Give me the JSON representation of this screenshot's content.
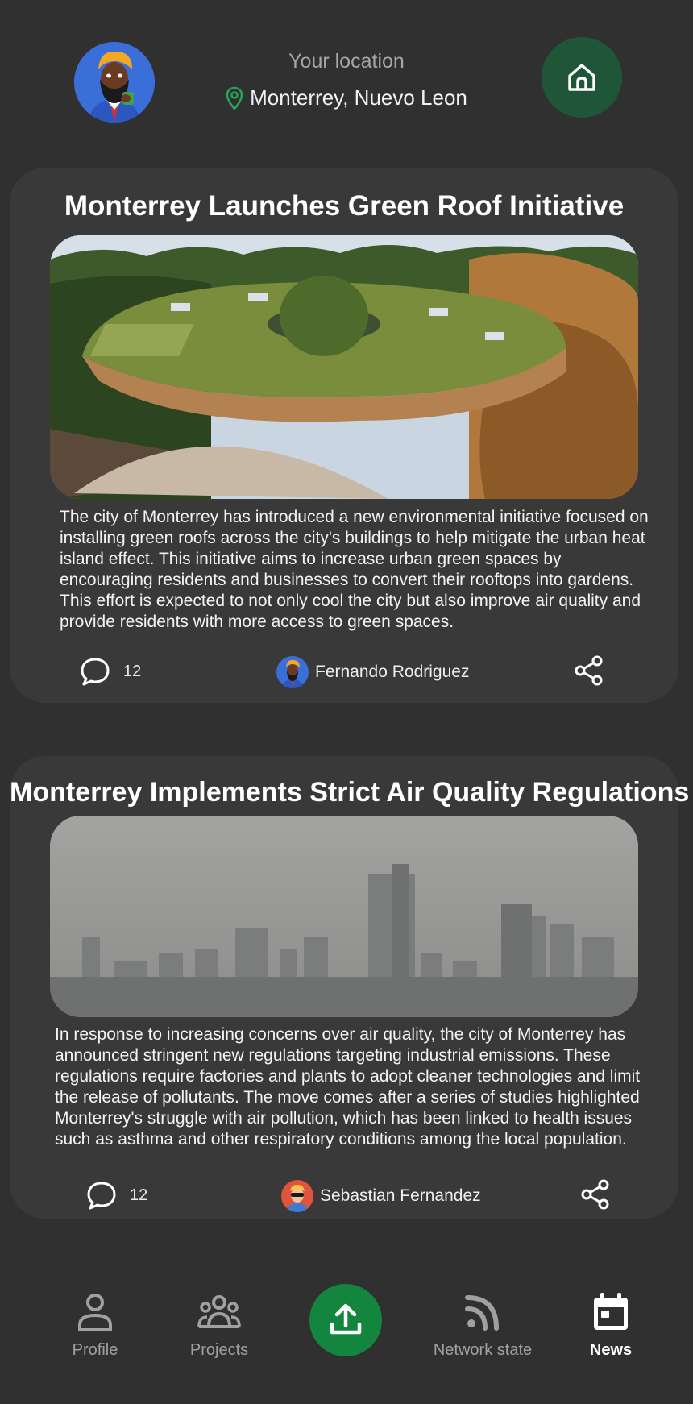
{
  "header": {
    "location_label": "Your location",
    "location_value": "Monterrey, Nuevo Leon",
    "avatar_icon": "user-avatar",
    "home_icon": "home-icon",
    "accent_color": "#13853f"
  },
  "news": [
    {
      "title": "Monterrey Launches Green Roof Initiative",
      "image": "green-roof-building-photo",
      "body": "The city of Monterrey has introduced a new environmental initiative focused on installing green roofs across the city's buildings to help mitigate the urban heat island effect. This initiative aims to increase urban green spaces by encouraging residents and businesses to convert their rooftops into gardens. This effort is expected to not only cool the city but also improve air quality and provide residents with more access to green spaces.",
      "comments": "12",
      "author": "Fernando Rodriguez"
    },
    {
      "title": "Monterrey Implements Strict Air Quality Regulations",
      "image": "smoggy-skyline-photo",
      "body": "In response to increasing concerns over air quality, the city of Monterrey has announced stringent new regulations targeting industrial emissions. These regulations require factories and plants to adopt cleaner technologies and limit the release of pollutants. The move comes after a series of studies highlighted Monterrey's struggle with air pollution, which has been linked to health issues such as asthma and other respiratory conditions among the local population.",
      "comments": "12",
      "author": "Sebastian Fernandez"
    }
  ],
  "nav": {
    "profile": "Profile",
    "projects": "Projects",
    "network": "Network state",
    "news": "News",
    "active": "News"
  }
}
